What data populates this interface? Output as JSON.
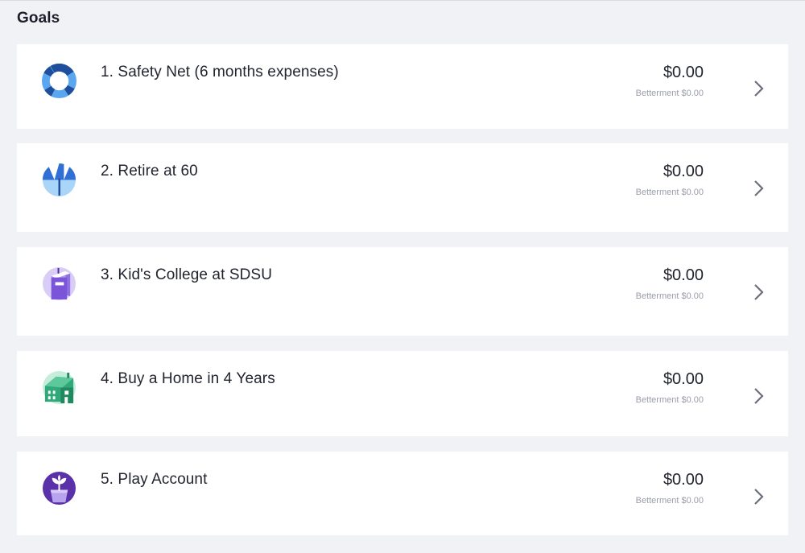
{
  "header": {
    "title": "Goals"
  },
  "goals": [
    {
      "name": "1. Safety Net (6 months expenses)",
      "balance": "$0.00",
      "sub": "Betterment $0.00",
      "icon": "life-ring-icon"
    },
    {
      "name": "2. Retire at 60",
      "balance": "$0.00",
      "sub": "Betterment $0.00",
      "icon": "beach-umbrella-icon"
    },
    {
      "name": "3. Kid's College at SDSU",
      "balance": "$0.00",
      "sub": "Betterment $0.00",
      "icon": "book-icon"
    },
    {
      "name": "4. Buy a Home in 4 Years",
      "balance": "$0.00",
      "sub": "Betterment $0.00",
      "icon": "house-icon"
    },
    {
      "name": "5. Play Account",
      "balance": "$0.00",
      "sub": "Betterment $0.00",
      "icon": "plant-pot-icon"
    }
  ],
  "colors": {
    "background": "#f1f2f6",
    "card": "#ffffff",
    "text": "#22252f",
    "subtext": "#9a9eab",
    "safety_net": "#3f8fe0",
    "retire": "#2f6fd6",
    "college": "#8f6fe6",
    "home": "#2fa87a",
    "play": "#5a31a8"
  }
}
